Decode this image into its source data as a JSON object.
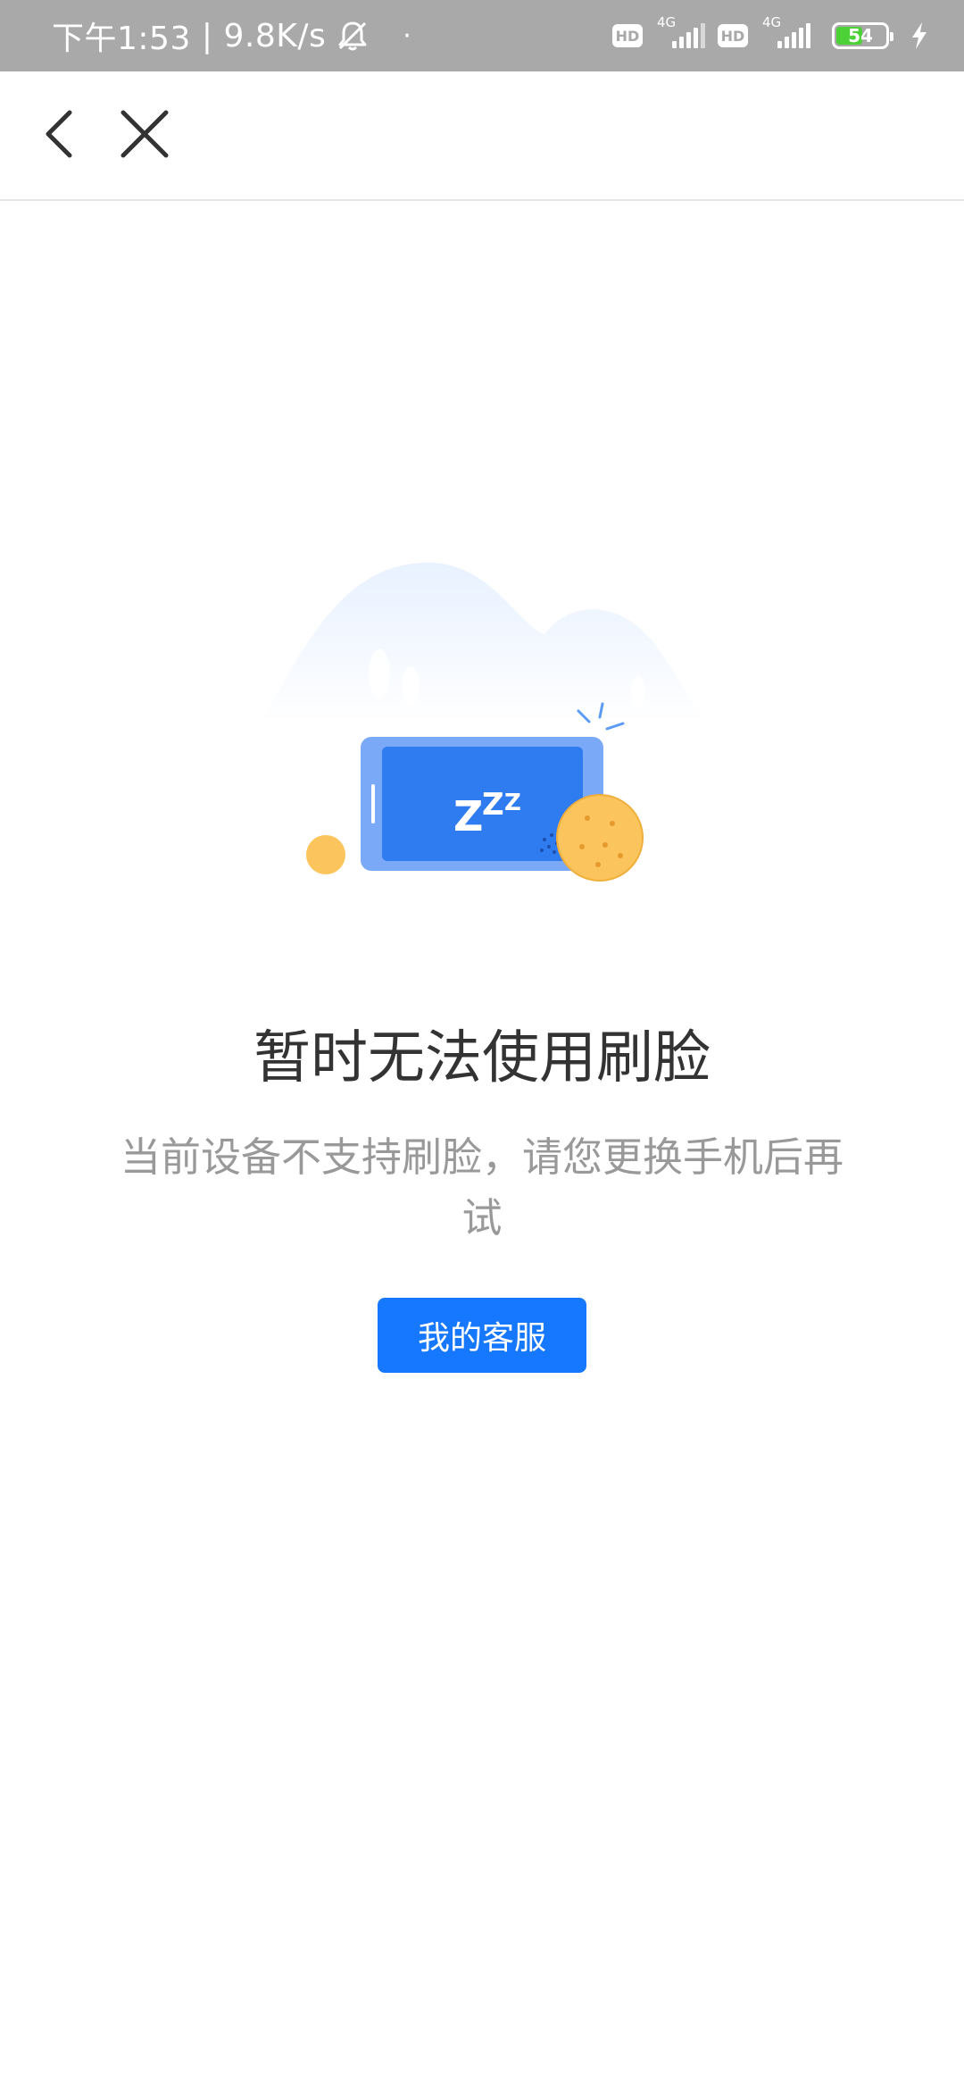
{
  "status_bar": {
    "time": "下午1:53",
    "separator": "|",
    "net_speed": "9.8K/s",
    "dot": "·",
    "sim1": {
      "hd": "HD",
      "network": "4G"
    },
    "sim2": {
      "hd": "HD",
      "network": "4G"
    },
    "battery_level": "54",
    "battery_fraction": 0.54,
    "icons": [
      "bell-muted-icon",
      "signal-icon",
      "battery-icon",
      "charging-bolt-icon"
    ]
  },
  "nav": {
    "back_icon": "back-arrow-icon",
    "close_icon": "close-icon"
  },
  "illustration": {
    "zzz_text": "Z",
    "icon": "sleeping-phone-illustration"
  },
  "message": {
    "title": "暂时无法使用刷脸",
    "subtitle": "当前设备不支持刷脸，请您更换手机后再试"
  },
  "actions": {
    "customer_service_label": "我的客服"
  },
  "colors": {
    "status_bar_bg": "#a9a9a9",
    "primary": "#1677ff",
    "title_text": "#333333",
    "subtitle_text": "#999999",
    "illustration_blue": "#2f7bf0",
    "illustration_orange": "#fbc45c",
    "battery_green": "#4cd137"
  }
}
